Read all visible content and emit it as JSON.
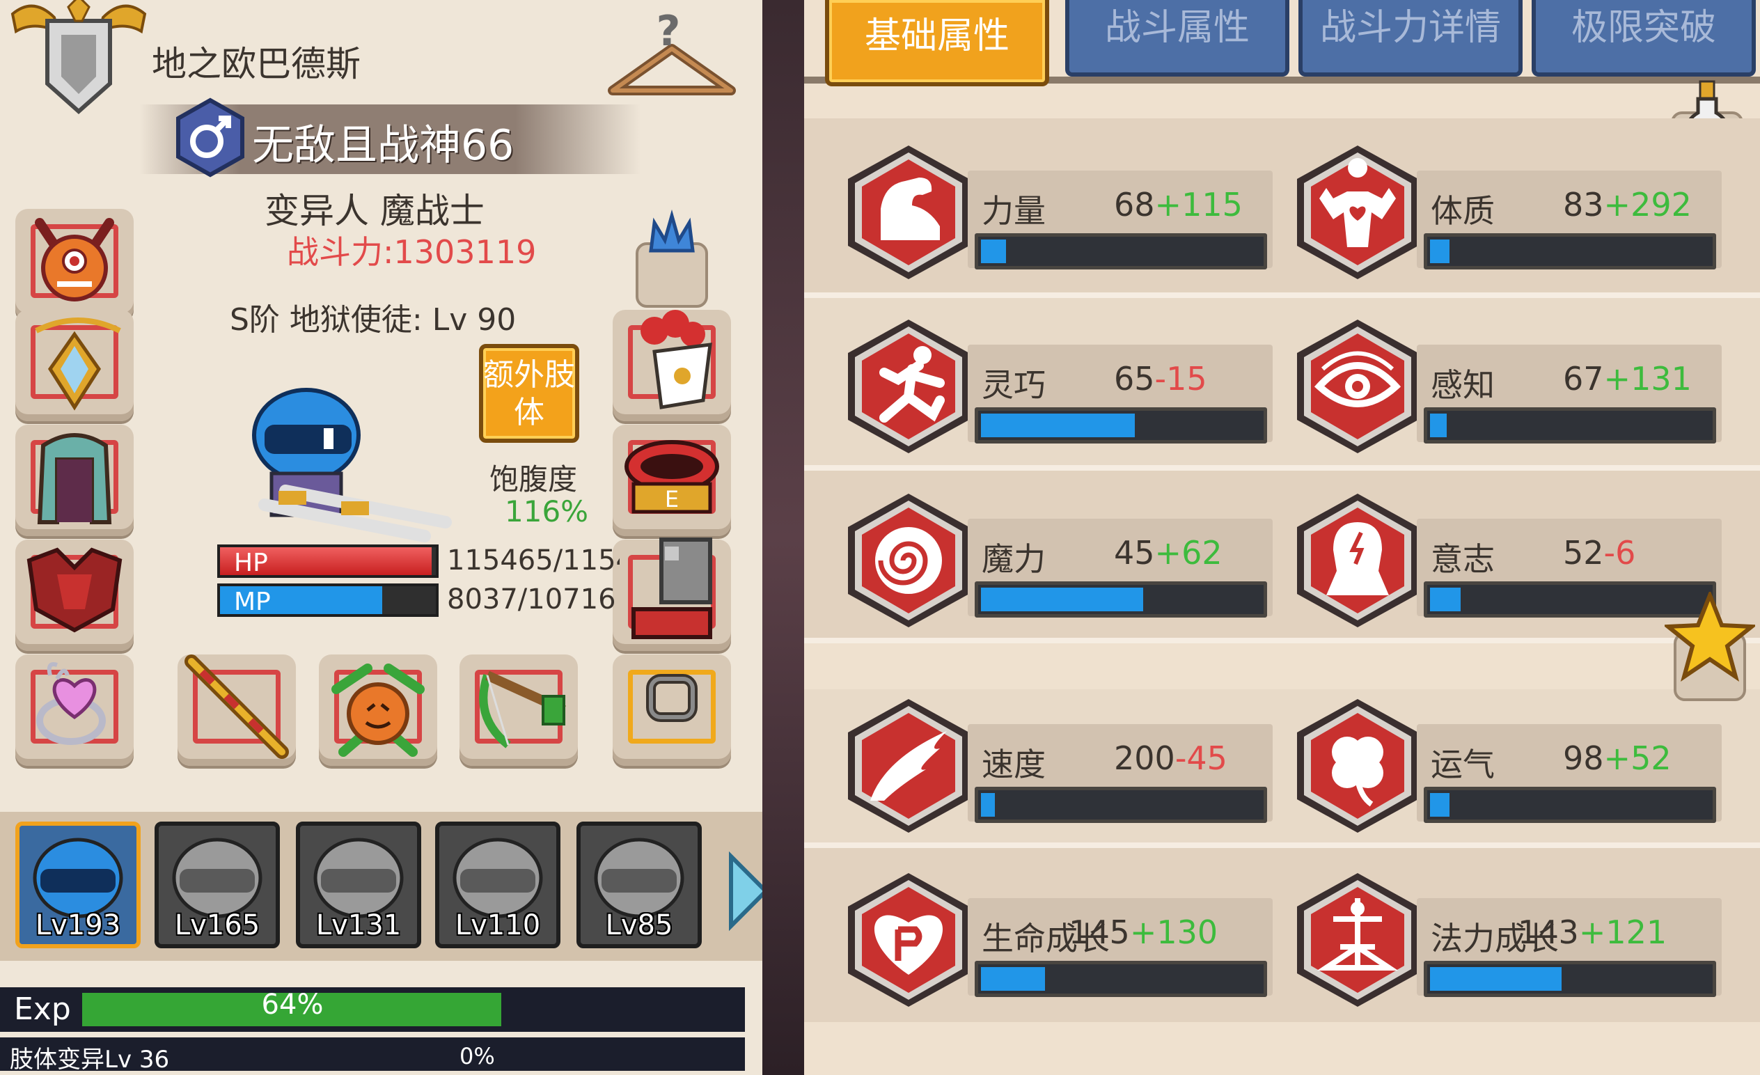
{
  "character": {
    "guild_name": "地之欧巴德斯",
    "player_name": "无敌且战神66",
    "race_class": "变异人 魔战士",
    "combat_power": "战斗力:1303119",
    "rank_line": "S阶 地狱使徒: Lv 90",
    "extra_limb_button": "额外肢体",
    "satiety_label": "饱腹度",
    "satiety_value": "116%",
    "hp": {
      "label": "HP",
      "value": "115465/1154",
      "fill_fraction": 0.98
    },
    "mp": {
      "label": "MP",
      "value": "8037/10716",
      "fill_fraction": 0.75
    }
  },
  "heroes": [
    {
      "level": "Lv193",
      "active": true
    },
    {
      "level": "Lv165",
      "active": false
    },
    {
      "level": "Lv131",
      "active": false
    },
    {
      "level": "Lv110",
      "active": false
    },
    {
      "level": "Lv85",
      "active": false
    }
  ],
  "exp": {
    "label": "Exp",
    "percent": "64%",
    "fraction": 0.64
  },
  "limb_mutation": {
    "label": "肢体变异Lv 36",
    "percent": "0%"
  },
  "tabs": [
    {
      "label": "基础属性",
      "active": true
    },
    {
      "label": "战斗属性",
      "active": false
    },
    {
      "label": "战斗力详情",
      "active": false
    },
    {
      "label": "极限突破",
      "active": false
    }
  ],
  "stats": [
    {
      "name": "力量",
      "base": "68",
      "bonus": "+115",
      "bonus_sign": "pos",
      "fill_fraction": 0.09,
      "icon": "arm-icon"
    },
    {
      "name": "体质",
      "base": "83",
      "bonus": "+292",
      "bonus_sign": "pos",
      "fill_fraction": 0.07,
      "icon": "body-icon"
    },
    {
      "name": "灵巧",
      "base": "65",
      "bonus": "-15",
      "bonus_sign": "neg",
      "fill_fraction": 0.55,
      "icon": "runner-icon"
    },
    {
      "name": "感知",
      "base": "67",
      "bonus": "+131",
      "bonus_sign": "pos",
      "fill_fraction": 0.06,
      "icon": "eye-icon"
    },
    {
      "name": "魔力",
      "base": "45",
      "bonus": "+62",
      "bonus_sign": "pos",
      "fill_fraction": 0.58,
      "icon": "spiral-icon"
    },
    {
      "name": "意志",
      "base": "52",
      "bonus": "-6",
      "bonus_sign": "neg",
      "fill_fraction": 0.11,
      "icon": "head-icon"
    },
    {
      "name": "速度",
      "base": "200",
      "bonus": "-45",
      "bonus_sign": "neg",
      "fill_fraction": 0.05,
      "icon": "wing-icon"
    },
    {
      "name": "运气",
      "base": "98",
      "bonus": "+52",
      "bonus_sign": "pos",
      "fill_fraction": 0.07,
      "icon": "clover-icon"
    },
    {
      "name": "生命成长",
      "base": "145",
      "bonus": "+130",
      "bonus_sign": "pos",
      "fill_fraction": 0.23,
      "icon": "heart-icon"
    },
    {
      "name": "法力成长",
      "base": "143",
      "bonus": "+121",
      "bonus_sign": "pos",
      "fill_fraction": 0.47,
      "icon": "rune-icon"
    }
  ],
  "colors": {
    "hex_red": "#c8312f",
    "bar_blue": "#2196e8",
    "bonus_green": "#3dbb3d",
    "bonus_red": "#e24a4a",
    "tab_active": "#f1a21d",
    "tab_inactive": "#4d6fa6"
  }
}
